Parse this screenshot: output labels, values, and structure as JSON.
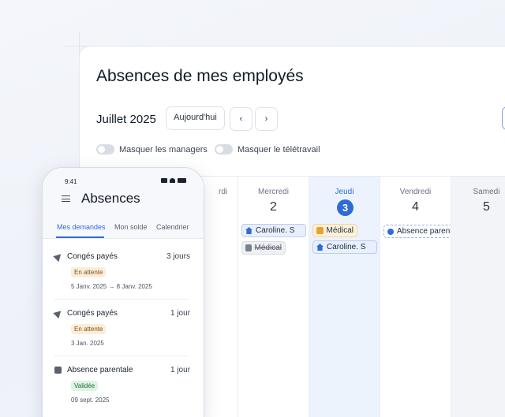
{
  "desktop": {
    "title": "Absences de mes employés",
    "month": "Juillet 2025",
    "today_label": "Aujourd'hui",
    "prev_glyph": "‹",
    "next_glyph": "›",
    "toggles": [
      "Masquer les managers",
      "Masquer le télétravail"
    ],
    "partial_day": "rdi",
    "days": [
      {
        "name": "Mercredi",
        "num": "2"
      },
      {
        "name": "Jeudi",
        "num": "3"
      },
      {
        "name": "Vendredi",
        "num": "4"
      },
      {
        "name": "Samedi",
        "num": "5"
      }
    ],
    "events": {
      "wed": [
        {
          "label": "Caroline. S",
          "icon": "home-icon"
        },
        {
          "label": "Médical",
          "icon": "medical-icon"
        }
      ],
      "thu": [
        {
          "label": "Médical",
          "icon": "medical-icon"
        },
        {
          "label": "Caroline. S",
          "icon": "home-icon"
        }
      ],
      "fri": [
        {
          "label": "Absence parental",
          "icon": "family-icon"
        }
      ]
    },
    "colors": {
      "accent": "#2f6bd8",
      "warning": "#e9a32b",
      "success": "#1f6b3a"
    }
  },
  "phone": {
    "time": "9:41",
    "title": "Absences",
    "tabs": [
      "Mes demandes",
      "Mon solde",
      "Calendrier"
    ],
    "requests": [
      {
        "type": "Congés payés",
        "duration": "3 jours",
        "status": "En attente",
        "dates": "5 Janv. 2025 → 8 Janv. 2025",
        "icon": "plane-icon"
      },
      {
        "type": "Congés payés",
        "duration": "1 jour",
        "status": "En attente",
        "dates": "3 Jan. 2025",
        "icon": "plane-icon"
      },
      {
        "type": "Absence parentale",
        "duration": "1 jour",
        "status": "Validée",
        "dates": "09 sept. 2025",
        "icon": "family-icon"
      }
    ]
  }
}
